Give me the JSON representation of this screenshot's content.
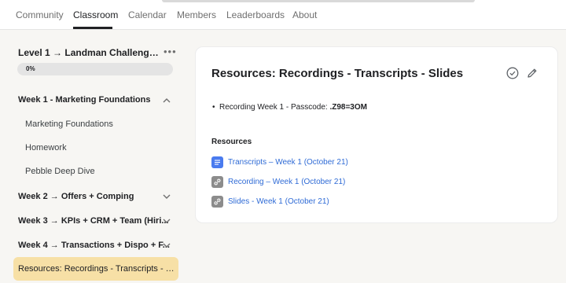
{
  "nav": {
    "tabs": [
      {
        "label": "Community"
      },
      {
        "label": "Classroom"
      },
      {
        "label": "Calendar"
      },
      {
        "label": "Members"
      },
      {
        "label": "Leaderboards"
      },
      {
        "label": "About"
      }
    ],
    "active_tab": "Classroom"
  },
  "sidebar": {
    "course_title": "Level 1 → Landman Challenge ($...",
    "progress_label": "0%",
    "progress_value": 0,
    "items": [
      {
        "label": "Week 1 - Marketing Foundations",
        "type": "section",
        "expanded": true
      },
      {
        "label": "Marketing Foundations",
        "type": "lesson"
      },
      {
        "label": "Homework",
        "type": "lesson"
      },
      {
        "label": "Pebble Deep Dive",
        "type": "lesson"
      },
      {
        "label": "Week 2 → Offers + Comping",
        "type": "section",
        "expanded": false
      },
      {
        "label": "Week 3 → KPIs + CRM + Team (Hiri...",
        "type": "section",
        "expanded": false
      },
      {
        "label": "Week 4 → Transactions + Dispo + F...",
        "type": "section",
        "expanded": false
      }
    ],
    "active_item": "Resources: Recordings - Transcripts - Slid..."
  },
  "lesson": {
    "title": "Resources: Recordings - Transcripts - Slides",
    "bullet_text": "Recording Week 1 - Passcode: ",
    "bullet_code": ".Z98=3OM",
    "resources_heading": "Resources",
    "resources": [
      {
        "label": "Transcripts – Week 1 (October 21)",
        "icon": "document-icon"
      },
      {
        "label": "Recording – Week 1 (October 21)",
        "icon": "link-icon"
      },
      {
        "label": "Slides - Week 1 (October 21)",
        "icon": "link-icon"
      }
    ]
  },
  "colors": {
    "background": "#f7f6f3",
    "active_highlight": "#f7e0a6",
    "link": "#2f6bd6",
    "doc_icon": "#4a7bef",
    "link_icon": "#8c8c8c"
  }
}
